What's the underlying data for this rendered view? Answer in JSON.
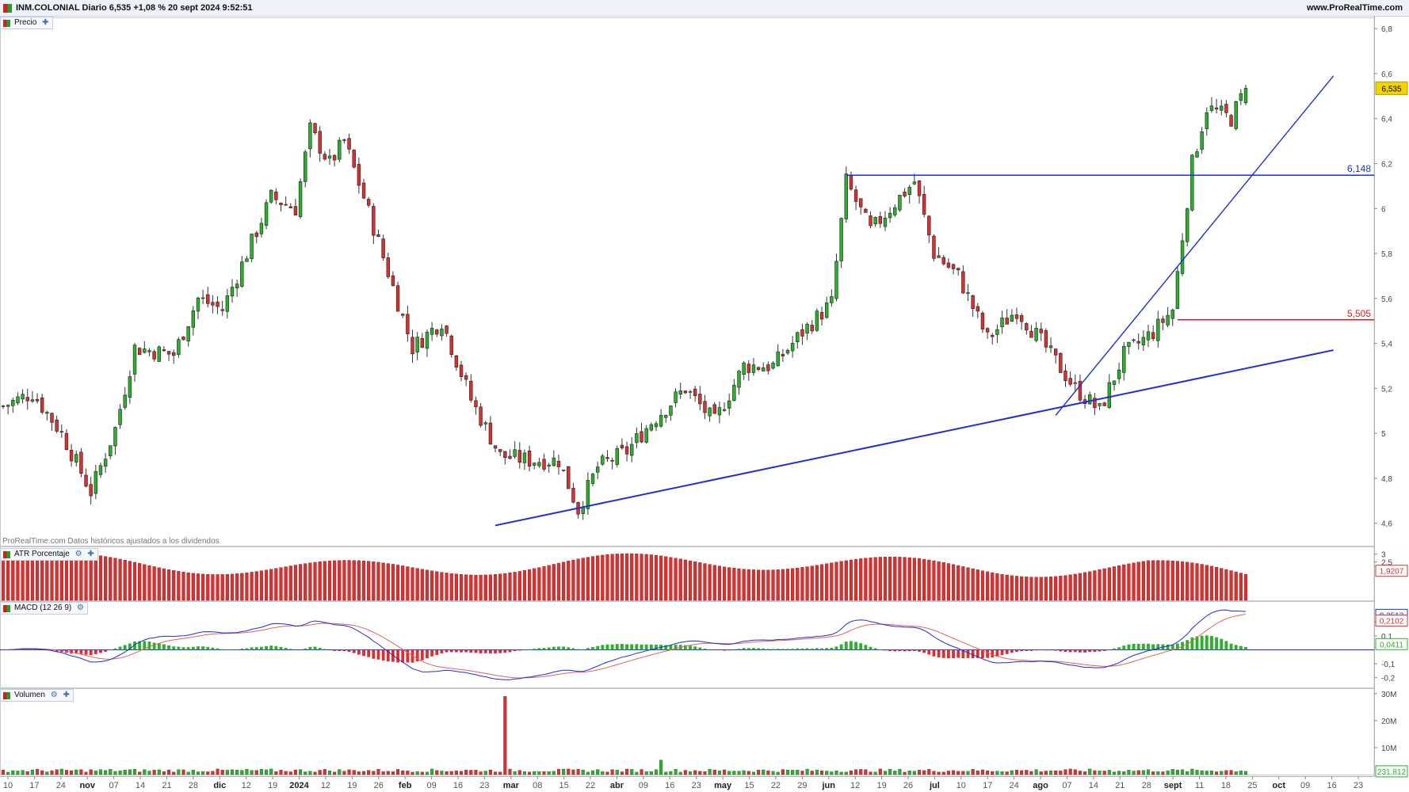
{
  "header": {
    "title": "INM.COLONIAL Diario 6,535 +1,08 % 20 sept 2024 9:52:51",
    "site": "www.ProRealTime.com"
  },
  "panels": {
    "price_label": "Precio",
    "atr_label": "ATR Porcentaje",
    "macd_label": "MACD (12 26 9)",
    "volume_label": "Volumen",
    "footnote": "ProRealTime.com  Datos históricos ajustados a los dividendos"
  },
  "colors": {
    "up": "#2bb02b",
    "down": "#d93030",
    "line": "#1d2fd6",
    "support": "#e01b1b",
    "signal": "#e06060"
  },
  "chart_data": [
    {
      "type": "candlestick",
      "title": "INM.COLONIAL Diario",
      "xlabel": "",
      "ylabel": "",
      "ylim": [
        4.5,
        6.85
      ],
      "y_ticks": [
        "4,6",
        "4,8",
        "5",
        "5,2",
        "5,4",
        "5,6",
        "5,8",
        "6",
        "6,2",
        "6,4",
        "6,6",
        "6,8"
      ],
      "x_ticks": [
        "10",
        "17",
        "24",
        "nov",
        "07",
        "14",
        "21",
        "28",
        "dic",
        "12",
        "19",
        "2024",
        "12",
        "19",
        "26",
        "feb",
        "09",
        "16",
        "23",
        "mar",
        "08",
        "15",
        "22",
        "abr",
        "09",
        "16",
        "23",
        "may",
        "15",
        "22",
        "29",
        "jun",
        "12",
        "19",
        "26",
        "jul",
        "10",
        "17",
        "24",
        "ago",
        "07",
        "14",
        "21",
        "28",
        "sept",
        "11",
        "18",
        "25",
        "oct",
        "09",
        "16",
        "23"
      ],
      "last_price_label": "6,535",
      "series": [
        {
          "name": "candles",
          "start": "2023-10-06",
          "end": "2024-09-20",
          "trading_days": 247,
          "anchors": [
            [
              0,
              5.12
            ],
            [
              6,
              5.18
            ],
            [
              12,
              5.0
            ],
            [
              18,
              4.74
            ],
            [
              23,
              5.02
            ],
            [
              27,
              5.38
            ],
            [
              35,
              5.35
            ],
            [
              40,
              5.6
            ],
            [
              45,
              5.55
            ],
            [
              50,
              5.8
            ],
            [
              55,
              6.05
            ],
            [
              60,
              6.0
            ],
            [
              63,
              6.35
            ],
            [
              67,
              6.2
            ],
            [
              70,
              6.3
            ],
            [
              74,
              6.05
            ],
            [
              80,
              5.65
            ],
            [
              84,
              5.38
            ],
            [
              90,
              5.5
            ],
            [
              96,
              5.15
            ],
            [
              102,
              4.9
            ],
            [
              108,
              4.88
            ],
            [
              114,
              4.88
            ],
            [
              118,
              4.66
            ],
            [
              122,
              4.85
            ],
            [
              128,
              4.92
            ],
            [
              133,
              5.05
            ],
            [
              140,
              5.2
            ],
            [
              146,
              5.05
            ],
            [
              152,
              5.3
            ],
            [
              158,
              5.3
            ],
            [
              164,
              5.45
            ],
            [
              170,
              5.58
            ],
            [
              173,
              6.12
            ],
            [
              178,
              5.9
            ],
            [
              184,
              6.05
            ],
            [
              187,
              6.12
            ],
            [
              191,
              5.8
            ],
            [
              196,
              5.7
            ],
            [
              202,
              5.42
            ],
            [
              208,
              5.55
            ],
            [
              214,
              5.38
            ],
            [
              220,
              5.2
            ],
            [
              225,
              5.1
            ],
            [
              230,
              5.35
            ],
            [
              236,
              5.45
            ],
            [
              240,
              5.55
            ],
            [
              244,
              6.2
            ],
            [
              247,
              6.45
            ],
            [
              252,
              6.4
            ],
            [
              255,
              6.535
            ]
          ]
        }
      ],
      "annotations": [
        {
          "label": "6,148",
          "kind": "resistance",
          "value": 6.148
        },
        {
          "label": "5,505",
          "kind": "support",
          "value": 5.505
        }
      ],
      "trendlines": [
        {
          "from": [
            "2024-02-26",
            4.59
          ],
          "to": [
            "2024-10-23",
            5.37
          ]
        },
        {
          "from": [
            "2024-08-05",
            5.08
          ],
          "to": [
            "2024-10-23",
            6.59
          ]
        }
      ]
    },
    {
      "type": "bar",
      "title": "ATR Porcentaje",
      "ylim": [
        0,
        3.5
      ],
      "y_ticks": [
        "2,5",
        "3"
      ],
      "last_value_label": "1,9207"
    },
    {
      "type": "line",
      "title": "MACD (12 26 9)",
      "ylim": [
        -0.27,
        0.35
      ],
      "y_ticks": [
        "0,2",
        "0,1",
        "-0,1",
        "-0,2"
      ],
      "value_labels": [
        "0,2513",
        "0,2102",
        "0,0411"
      ]
    },
    {
      "type": "bar",
      "title": "Volumen",
      "ylim": [
        0,
        32
      ],
      "y_ticks": [
        "30M",
        "20M",
        "10M"
      ],
      "last_value_label": "231.812",
      "spike": {
        "date": "2024-02-28",
        "value": 29
      }
    }
  ]
}
